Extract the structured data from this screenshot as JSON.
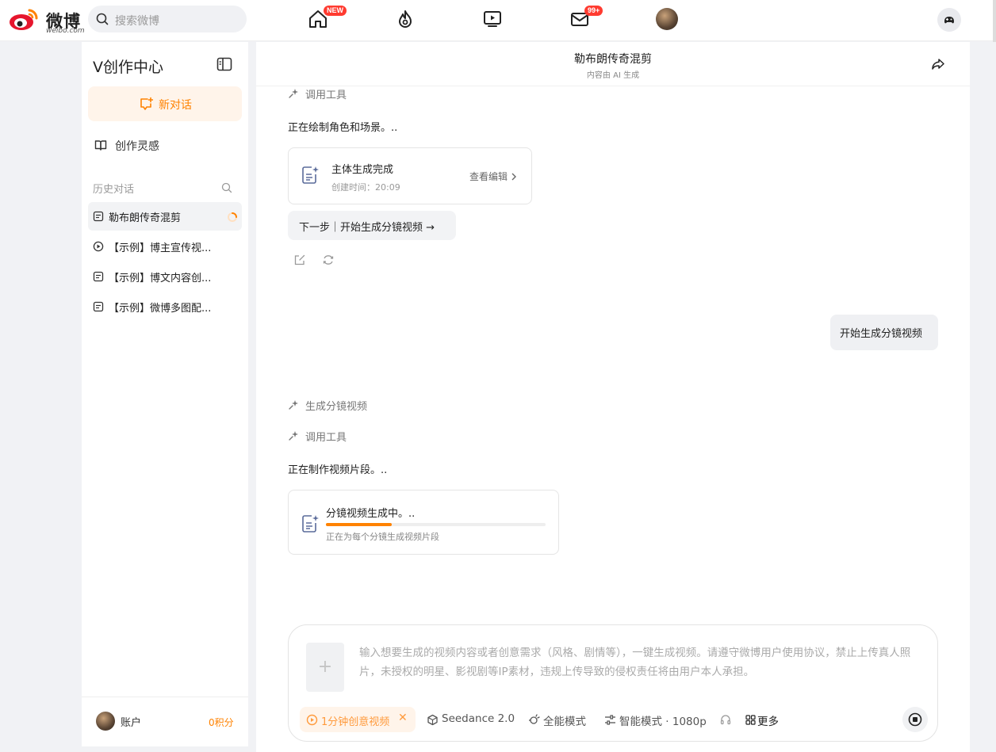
{
  "topbar": {
    "logo_text": "微博",
    "logo_sub": "weibo.com",
    "search_placeholder": "搜索微博",
    "home_badge": "NEW",
    "mail_badge": "99+"
  },
  "sidebar": {
    "title": "V创作中心",
    "new_chat_label": "新对话",
    "inspiration_label": "创作灵感",
    "history_label": "历史对话",
    "history_items": [
      {
        "label": "勒布朗传奇混剪",
        "icon": "doc-icon",
        "active": true
      },
      {
        "label": "【示例】博主宣传视...",
        "icon": "play-icon",
        "active": false
      },
      {
        "label": "【示例】博文内容创...",
        "icon": "doc-icon",
        "active": false
      },
      {
        "label": "【示例】微博多图配...",
        "icon": "doc-icon",
        "active": false
      }
    ],
    "account_label": "账户",
    "points_label": "0积分"
  },
  "conversation": {
    "title": "勒布朗传奇混剪",
    "subtitle": "内容由 AI 生成",
    "tool_call_1": "调用工具",
    "msg_drawing": "正在绘制角色和场景。..",
    "card_main": {
      "title": "主体生成完成",
      "time_label": "创建时间：",
      "time_value": "20:09",
      "link": "查看编辑"
    },
    "next_step_button": "下一步｜开始生成分镜视频 →",
    "user_message": "开始生成分镜视频",
    "step_generate": "生成分镜视频",
    "tool_call_2": "调用工具",
    "msg_making": "正在制作视频片段。..",
    "card_progress": {
      "title": "分镜视频生成中。..",
      "progress": 0.3,
      "description": "正在为每个分镜生成视频片段"
    }
  },
  "composer": {
    "placeholder": "输入想要生成的视频内容或者创意需求（风格、剧情等），一键生成视频。请遵守微博用户使用协议，禁止上传真人照片，未授权的明星、影视剧等IP素材，违规上传导致的侵权责任将由用户本人承担。",
    "upload_plus": "+",
    "chip_label": "1分钟创意视频",
    "chip_close": "✕",
    "model_label": "Seedance 2.0",
    "mode_label": "全能模式",
    "quality_label": "智能模式 · 1080p",
    "more_label": "更多"
  },
  "colors": {
    "accent": "#ff8200",
    "badge_red": "#ff3b30",
    "bg": "#f1f2f5"
  }
}
